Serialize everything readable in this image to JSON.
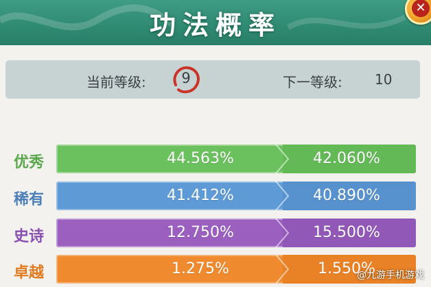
{
  "header": {
    "title": "功法概率",
    "close_icon": "close-icon"
  },
  "level": {
    "current_label": "当前等级:",
    "current_value": "9",
    "next_label": "下一等级:",
    "next_value": "10"
  },
  "rows": [
    {
      "label": "优秀",
      "current": "44.563%",
      "next": "42.060%",
      "color": "#6cc15f",
      "label_color": "#5aa84b"
    },
    {
      "label": "稀有",
      "current": "41.412%",
      "next": "40.890%",
      "color": "#5d9ad6",
      "label_color": "#4c7fb8"
    },
    {
      "label": "史诗",
      "current": "12.750%",
      "next": "15.500%",
      "color": "#9a5fbf",
      "label_color": "#8a4fb0"
    },
    {
      "label": "卓越",
      "current": "1.275%",
      "next": "1.550%",
      "color": "#ef8a2e",
      "label_color": "#e27a1e"
    }
  ],
  "watermark": "@九游手机游戏"
}
